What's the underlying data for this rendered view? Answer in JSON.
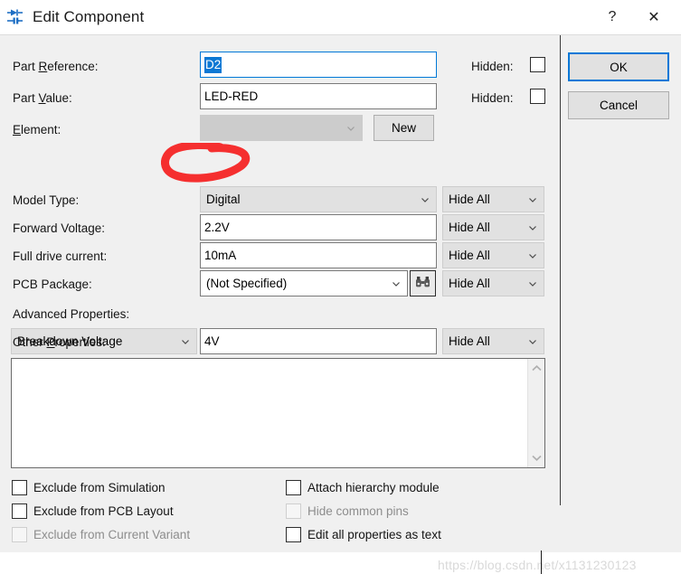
{
  "window": {
    "title": "Edit Component",
    "icon": "component-diode-icon",
    "help_label": "?",
    "close_label": "✕"
  },
  "form": {
    "part_reference": {
      "label_pre": "Part ",
      "label_mnemonic": "R",
      "label_post": "eference:",
      "value": "D2",
      "hidden_label": "Hidden:",
      "hidden_checked": false
    },
    "part_value": {
      "label_pre": "Part ",
      "label_mnemonic": "V",
      "label_post": "alue:",
      "value": "LED-RED",
      "hidden_label": "Hidden:",
      "hidden_checked": false
    },
    "element": {
      "label_pre": "",
      "label_mnemonic": "E",
      "label_post": "lement:",
      "value": "",
      "disabled": true,
      "new_button": "New"
    },
    "model_type": {
      "label": "Model Type:",
      "value": "Digital",
      "visibility": "Hide All"
    },
    "forward_voltage": {
      "label": "Forward Voltage:",
      "value": "2.2V",
      "visibility": "Hide All"
    },
    "full_drive_current": {
      "label": "Full drive current:",
      "value": "10mA",
      "visibility": "Hide All"
    },
    "pcb_package": {
      "label": "PCB Package:",
      "value": "(Not Specified)",
      "visibility": "Hide All",
      "browse_icon": "binoculars-icon"
    },
    "advanced_properties": {
      "label": "Advanced Properties:",
      "property_name": "Breakdown Voltage",
      "property_value": "4V",
      "visibility": "Hide All"
    },
    "other_properties": {
      "label_pre": "Other ",
      "label_mnemonic": "P",
      "label_post": "roperties:",
      "value": ""
    }
  },
  "checkboxes": {
    "left": [
      {
        "label": "Exclude from Simulation",
        "checked": false,
        "disabled": false
      },
      {
        "label": "Exclude from PCB Layout",
        "checked": false,
        "disabled": false
      },
      {
        "label": "Exclude from Current Variant",
        "checked": false,
        "disabled": true
      }
    ],
    "right": [
      {
        "label": "Attach hierarchy module",
        "checked": false,
        "disabled": false
      },
      {
        "label": "Hide common pins",
        "checked": false,
        "disabled": true
      },
      {
        "label": "Edit all properties as text",
        "checked": false,
        "disabled": false
      }
    ]
  },
  "actions": {
    "ok_label": "OK",
    "cancel_label": "Cancel"
  },
  "annotation": {
    "type": "hand-drawn-red-circle",
    "target": "Digital",
    "color": "#f52f2f"
  },
  "watermark": {
    "text": "https://blog.csdn.net/x1131230123"
  },
  "colors": {
    "dialog_background": "#f0f0f0",
    "accent_blue": "#0078d7",
    "selection_blue": "#0a78d4",
    "annotation_red": "#f52f2f"
  }
}
